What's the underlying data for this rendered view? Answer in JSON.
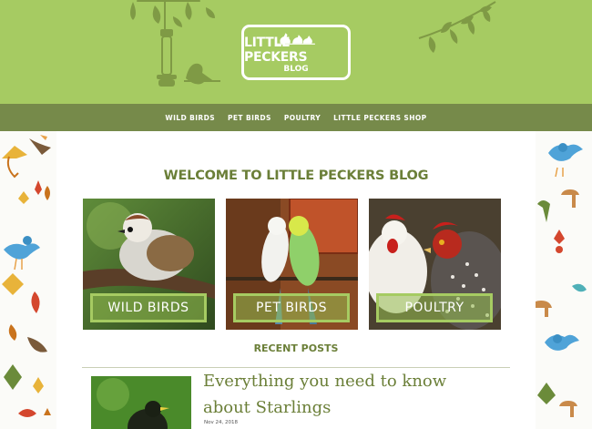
{
  "logo": {
    "title": "LITTLE PECKERS",
    "subtitle": "BLOG"
  },
  "nav": {
    "items": [
      {
        "label": "WILD BIRDS"
      },
      {
        "label": "PET BIRDS"
      },
      {
        "label": "POULTRY"
      },
      {
        "label": "LITTLE PECKERS SHOP"
      }
    ]
  },
  "main": {
    "welcome": "WELCOME TO LITTLE PECKERS BLOG",
    "categories": [
      {
        "label": "WILD BIRDS"
      },
      {
        "label": "PET BIRDS"
      },
      {
        "label": "POULTRY"
      }
    ],
    "recent_heading": "RECENT POSTS",
    "post": {
      "title": "Everything you need to know about Starlings",
      "date": "Nov 24, 2018"
    }
  },
  "colors": {
    "header_green": "#a6cb62",
    "nav_green": "#768a4a",
    "heading_green": "#6b7f38"
  },
  "icons": [
    "bird-feeder-icon",
    "branch-icon",
    "chickens-icon",
    "leaf-pattern"
  ]
}
